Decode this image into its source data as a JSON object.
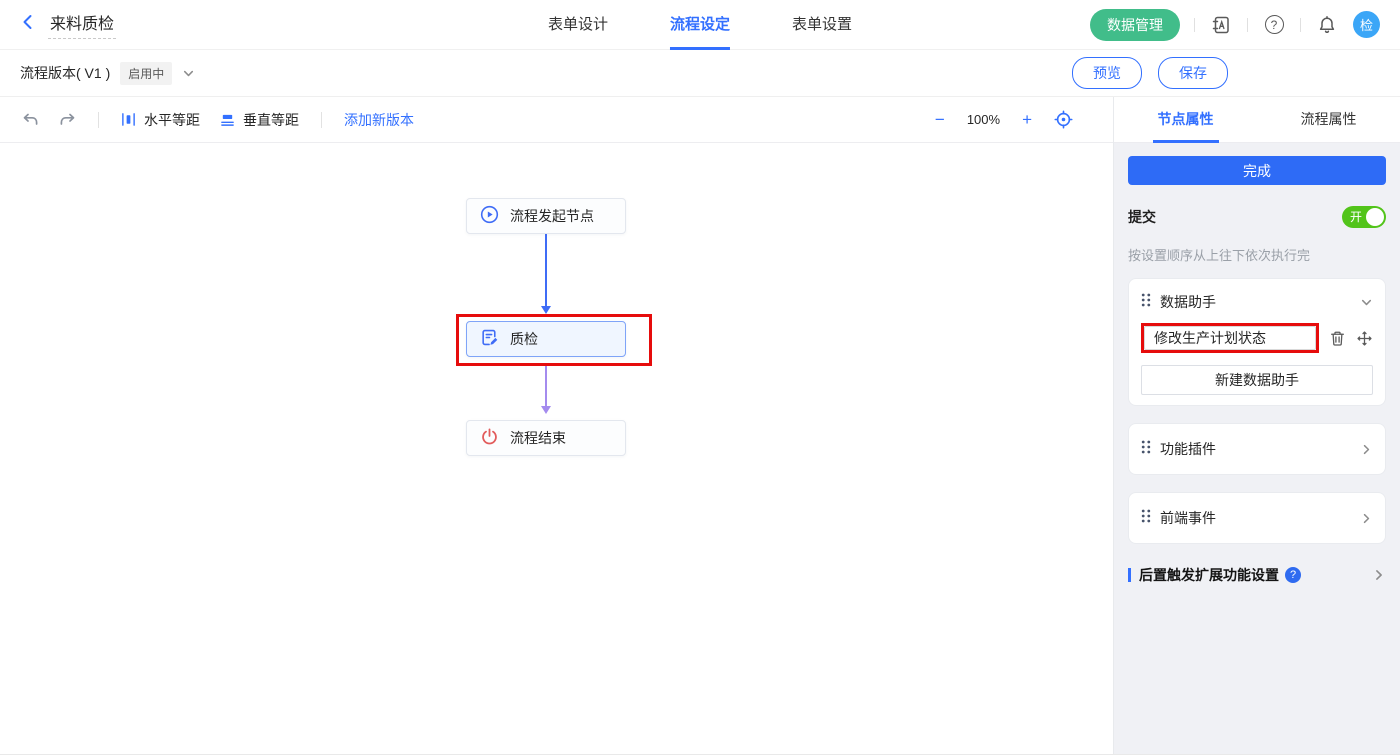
{
  "colors": {
    "accent_blue": "#3370ff",
    "green_button": "#41bd8a",
    "toggle_green": "#52c41a",
    "annotation_red": "#e60c0c",
    "arrow_blue": "#3f6cf6",
    "arrow_purple": "#a48bee",
    "avatar_blue": "#3ba6f7"
  },
  "header": {
    "title": "来料质检",
    "tabs": [
      {
        "label": "表单设计"
      },
      {
        "label": "流程设定"
      },
      {
        "label": "表单设置"
      }
    ],
    "data_manage_button": "数据管理",
    "help_glyph": "?",
    "avatar_text": "检",
    "icons": [
      "back-icon",
      "address-book-icon",
      "help-icon",
      "bell-icon"
    ]
  },
  "version_bar": {
    "version_label": "流程版本( V1 )",
    "status_badge": "启用中",
    "preview_button": "预览",
    "save_button": "保存"
  },
  "toolbar": {
    "horizontal_label": "水平等距",
    "vertical_label": "垂直等距",
    "add_version_label": "添加新版本",
    "zoom_out_glyph": "−",
    "zoom_level": "100%",
    "zoom_in_glyph": "+",
    "icons": [
      "undo-icon",
      "redo-icon",
      "horizontal-spacing-icon",
      "vertical-spacing-icon",
      "target-icon"
    ]
  },
  "canvas": {
    "nodes": [
      {
        "label": "流程发起节点",
        "icon": "play-icon"
      },
      {
        "label": "质检",
        "icon": "form-edit-icon",
        "selected": true,
        "annotated": true
      },
      {
        "label": "流程结束",
        "icon": "power-icon"
      }
    ]
  },
  "panel": {
    "tabs": [
      {
        "label": "节点属性"
      },
      {
        "label": "流程属性"
      }
    ],
    "done_button": "完成",
    "submit_label": "提交",
    "toggle_label": "开",
    "hint": "按设置顺序从上往下依次执行完",
    "data_assistant": {
      "title": "数据助手",
      "item_label": "修改生产计划状态",
      "new_button": "新建数据助手",
      "icons": [
        "drag-handle-icon",
        "chevron-down-icon",
        "trash-icon",
        "move-icon"
      ]
    },
    "plugin_title": "功能插件",
    "frontend_title": "前端事件",
    "post_trigger_title": "后置触发扩展功能设置",
    "post_trigger_help_glyph": "?"
  }
}
